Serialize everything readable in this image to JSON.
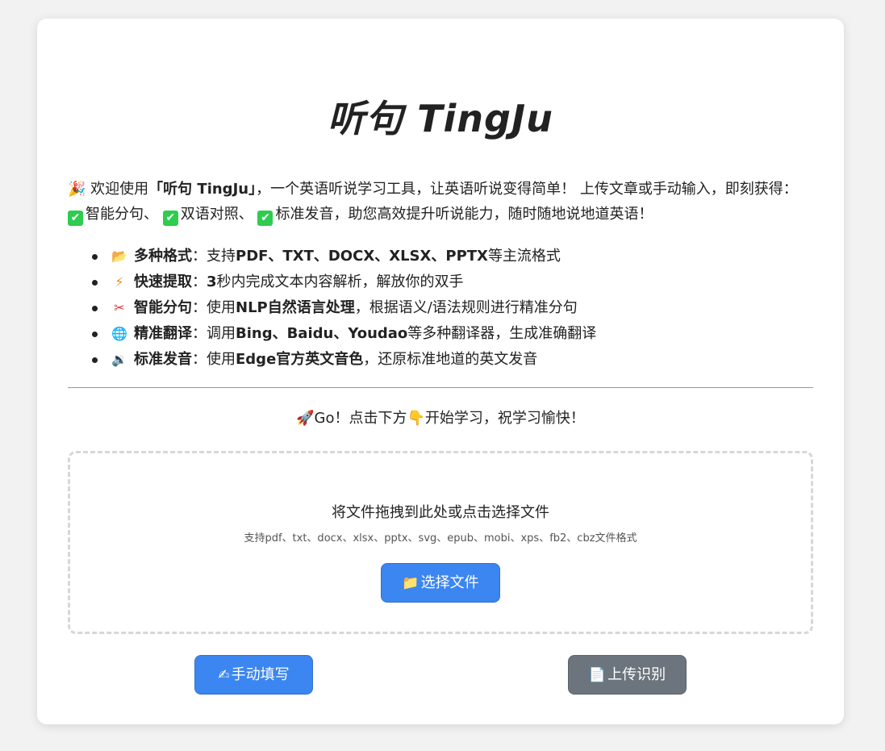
{
  "title": "听句 TingJu",
  "intro": {
    "emoji": "🎉",
    "lead": " 欢迎使用",
    "brand": "「听句 TingJu」",
    "middle": "，一个英语听说学习工具，让英语听说变得简单！ 上传文章或手动输入，即刻获得：",
    "feat1": "智能分句、",
    "feat2": "双语对照、",
    "feat3": "标准发音，助您高效提升听说能力，随时随地说地道英语！"
  },
  "features": [
    {
      "icon": "📂",
      "icon_name": "folder-icon",
      "title": "多种格式",
      "sep": "：",
      "pre": "支持",
      "strong": "PDF、TXT、DOCX、XLSX、PPTX",
      "post": "等主流格式"
    },
    {
      "icon": "⚡",
      "icon_name": "lightning-icon",
      "title": "快速提取",
      "sep": "：",
      "pre": "",
      "strong": "3",
      "post": "秒内完成文本内容解析，解放你的双手"
    },
    {
      "icon": "✂",
      "icon_name": "scissors-icon",
      "title": "智能分句",
      "sep": "：",
      "pre": "使用",
      "strong": "NLP自然语言处理",
      "post": "，根据语义/语法规则进行精准分句"
    },
    {
      "icon": "🌐",
      "icon_name": "globe-icon",
      "title": "精准翻译",
      "sep": "：",
      "pre": "调用",
      "strong": "Bing、Baidu、Youdao",
      "post": "等多种翻译器，生成准确翻译"
    },
    {
      "icon": "🔉",
      "icon_name": "speaker-icon",
      "title": "标准发音",
      "sep": "：",
      "pre": "使用",
      "strong": "Edge官方英文音色",
      "post": "，还原标准地道的英文发音"
    }
  ],
  "go": {
    "rocket": "🚀",
    "text1": "Go！点击下方",
    "hand": "👇",
    "text2": "开始学习，祝学习愉快！"
  },
  "dropzone": {
    "main": "将文件拖拽到此处或点击选择文件",
    "sub": "支持pdf、txt、docx、xlsx、pptx、svg、epub、mobi、xps、fb2、cbz文件格式",
    "button_icon": "📁",
    "button_label": "选择文件"
  },
  "actions": {
    "manual_icon": "✍",
    "manual_label": "手动填写",
    "upload_icon": "📄",
    "upload_label": "上传识别"
  },
  "colors": {
    "primary": "#3b86f0",
    "secondary": "#6c757d",
    "check": "#2ecc4f"
  }
}
